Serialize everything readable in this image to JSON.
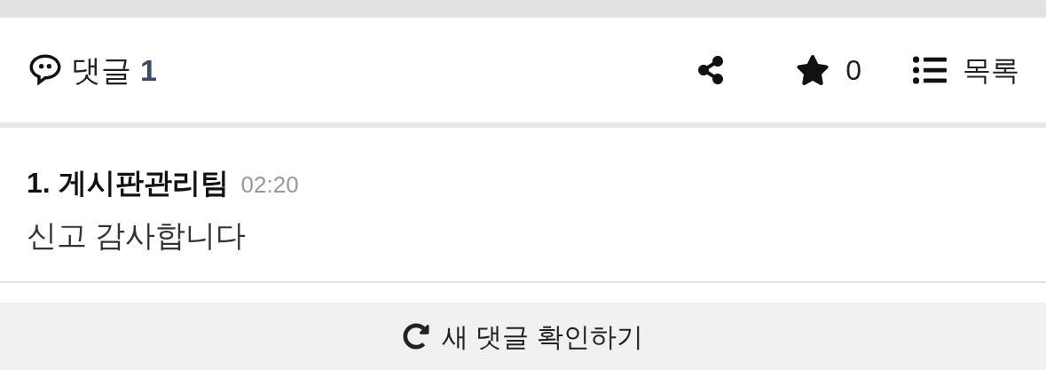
{
  "header": {
    "comments_label": "댓글",
    "comments_count": "1",
    "stars": "0",
    "list_label": "목록"
  },
  "comments": [
    {
      "number": "1.",
      "author": "게시판관리팀",
      "time": "02:20",
      "text": "신고 감사합니다"
    }
  ],
  "refresh_button": {
    "label": "새 댓글 확인하기"
  }
}
